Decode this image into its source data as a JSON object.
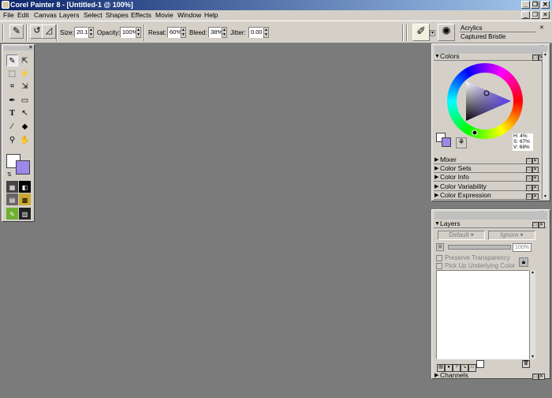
{
  "window": {
    "title": "Corel Painter 8 - [Untitled-1 @ 100%]"
  },
  "menu": [
    "File",
    "Edit",
    "Canvas",
    "Layers",
    "Select",
    "Shapes",
    "Effects",
    "Movie",
    "Window",
    "Help"
  ],
  "property_bar": {
    "size_label": "Size:",
    "size_value": "20.1",
    "opacity_label": "Opacity:",
    "opacity_value": "100%",
    "resat_label": "Resat:",
    "resat_value": "60%",
    "bleed_label": "Bleed:",
    "bleed_value": "38%",
    "jitter_label": "Jitter:",
    "jitter_value": "0.00"
  },
  "brush": {
    "category": "Acrylics",
    "variant": "Captured Bristle"
  },
  "colors_panel": {
    "title": "Colors",
    "hue": "H: 4%",
    "saturation": "S: 67%",
    "value": "V: 68%",
    "main_color": "#9b88e8",
    "secondary_color": "#ffffff"
  },
  "collapsed_panels": [
    "Mixer",
    "Color Sets",
    "Color Info",
    "Color Variability",
    "Color Expression"
  ],
  "layers_panel": {
    "title": "Layers",
    "composite_method": "Default",
    "composite_depth": "Ignore",
    "opacity": "100%",
    "preserve_transparency": "Preserve Transparency",
    "pick_up_underlying": "Pick Up Underlying Color"
  },
  "channels_panel": {
    "title": "Channels"
  }
}
